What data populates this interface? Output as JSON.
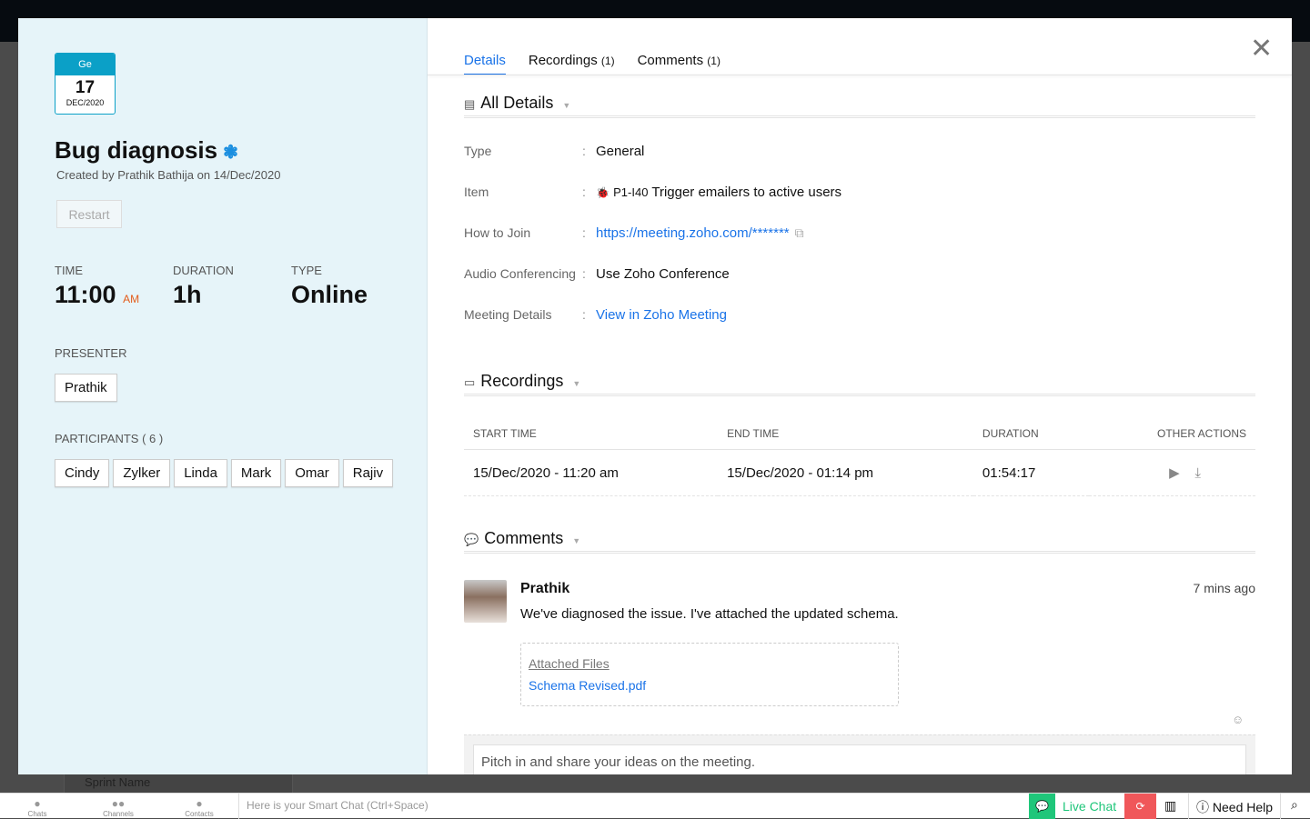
{
  "background": {
    "sprint_label": "Sprint Name"
  },
  "event": {
    "calendar": {
      "header": "Ge",
      "day": "17",
      "month_year": "DEC/2020"
    },
    "title": "Bug diagnosis",
    "created": "Created by Prathik Bathija on 14/Dec/2020",
    "restart_label": "Restart",
    "time_label": "TIME",
    "time": "11:00",
    "ampm": "AM",
    "duration_label": "DURATION",
    "duration": "1h",
    "type_label": "TYPE",
    "type": "Online",
    "presenter_label": "PRESENTER",
    "presenter": "Prathik",
    "participants_label": "PARTICIPANTS ( 6 )",
    "participants": [
      "Cindy",
      "Zylker",
      "Linda",
      "Mark",
      "Omar",
      "Rajiv"
    ]
  },
  "tabs": [
    {
      "label": "Details",
      "count": ""
    },
    {
      "label": "Recordings",
      "count": "(1)"
    },
    {
      "label": "Comments",
      "count": "(1)"
    }
  ],
  "details": {
    "heading": "All Details",
    "rows": [
      {
        "key": "Type",
        "value": "General"
      },
      {
        "key": "Item",
        "item_id": "P1-I40",
        "value": "Trigger emailers to active users"
      },
      {
        "key": "How to Join",
        "value": "https://meeting.zoho.com/*******"
      },
      {
        "key": "Audio Conferencing",
        "value": "Use Zoho Conference"
      },
      {
        "key": "Meeting Details",
        "value": "View in Zoho Meeting"
      }
    ]
  },
  "recordings": {
    "heading": "Recordings",
    "columns": [
      "START TIME",
      "END TIME",
      "DURATION",
      "OTHER ACTIONS"
    ],
    "rows": [
      {
        "start": "15/Dec/2020 - 11:20 am",
        "end": "15/Dec/2020 - 01:14 pm",
        "duration": "01:54:17"
      }
    ]
  },
  "comments": {
    "heading": "Comments",
    "items": [
      {
        "author": "Prathik",
        "time": "7 mins ago",
        "text": "We've diagnosed the issue. I've attached the updated schema.",
        "attached_label": "Attached Files",
        "file": "Schema Revised.pdf"
      }
    ],
    "placeholder": "Pitch in and share your ideas on the meeting."
  },
  "bottombar": {
    "chats": "Chats",
    "channels": "Channels",
    "contacts": "Contacts",
    "smart_chat": "Here is your Smart Chat (Ctrl+Space)",
    "live_chat": "Live Chat",
    "need_help": "Need Help"
  },
  "colors": {
    "accent": "#1a73e8",
    "calendar": "#0ba0c7",
    "live_chat": "#1fc67a",
    "panel": "#e6f4f9"
  }
}
